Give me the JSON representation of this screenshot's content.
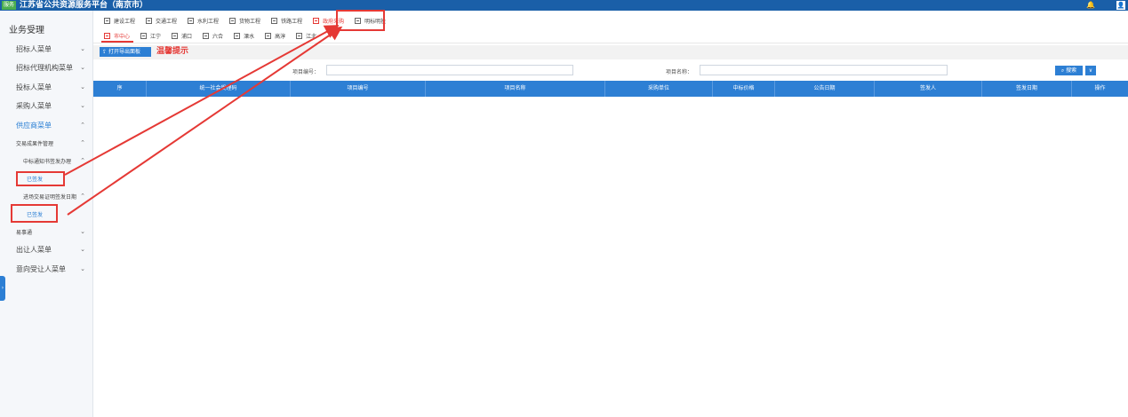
{
  "header": {
    "logo_text": "服务",
    "title": "江苏省公共资源服务平台（南京市）",
    "bell_icon": "bell-icon",
    "user_icon": "user-icon"
  },
  "sidebar": {
    "title": "业务受理",
    "items": [
      {
        "label": "招标人菜单",
        "chevron": "⌄"
      },
      {
        "label": "招标代理机构菜单",
        "chevron": "⌄"
      },
      {
        "label": "投标人菜单",
        "chevron": "⌄"
      },
      {
        "label": "采购人菜单",
        "chevron": "⌄"
      },
      {
        "label": "供应商菜单",
        "chevron": "⌃"
      },
      {
        "label": "交易成果件管理",
        "chevron": "⌃"
      },
      {
        "label": "中标通知书签发办理",
        "chevron": "⌃"
      },
      {
        "label": "已签发"
      },
      {
        "label": "进场交易证明签发日期",
        "chevron": "⌃"
      },
      {
        "label": "已签发"
      },
      {
        "label": "易事通",
        "chevron": "⌄"
      },
      {
        "label": "出让人菜单",
        "chevron": "⌄"
      },
      {
        "label": "意向受让人菜单",
        "chevron": "⌄"
      }
    ],
    "collapse": "›"
  },
  "tabs_primary": [
    "建设工程",
    "交通工程",
    "水利工程",
    "货物工程",
    "铁路工程",
    "政府采购",
    "明标明投"
  ],
  "tabs_secondary": [
    "市中心",
    "江宁",
    "浦口",
    "六合",
    "溧水",
    "高淳",
    "江北"
  ],
  "toolbar": {
    "export_label": "打开导出面板",
    "hint": "温馨提示"
  },
  "filters": {
    "project_code_label": "项目编号：",
    "project_name_label": "项目名称：",
    "project_code_value": "",
    "project_name_value": "",
    "search_label": "搜索",
    "more_label": "∨"
  },
  "table": {
    "columns": [
      "序",
      "统一社会受理码",
      "项目编号",
      "项目名称",
      "采购单位",
      "中标价格",
      "公告日期",
      "签发人",
      "签发日期",
      "操作"
    ],
    "rows": []
  },
  "colors": {
    "header_blue": "#1a5fa8",
    "accent_blue": "#2d7fd4",
    "annotation_red": "#e53935"
  }
}
